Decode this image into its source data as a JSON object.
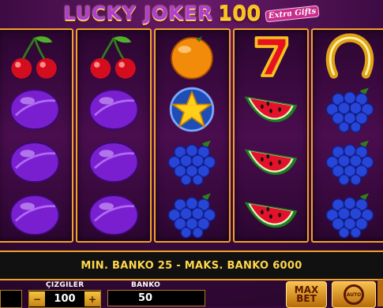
{
  "title": {
    "main": "LUCKY JOKER",
    "number": "100",
    "extra": "Extra Gifts"
  },
  "reels": [
    [
      "cherries",
      "plum",
      "plum",
      "plum"
    ],
    [
      "cherries",
      "plum",
      "plum",
      "plum"
    ],
    [
      "orange",
      "star",
      "grapes",
      "grapes"
    ],
    [
      "seven",
      "watermelon",
      "watermelon",
      "watermelon"
    ],
    [
      "horseshoe",
      "grapes",
      "grapes",
      "grapes"
    ]
  ],
  "info_text": "MIN. BANKO 25 - MAKS. BANKO 6000",
  "lines": {
    "label": "ÇIZGILER",
    "value": "100",
    "minus": "−",
    "plus": "+"
  },
  "bank": {
    "label": "BANKO",
    "value": "50"
  },
  "buttons": {
    "max": "MAX",
    "bet": "BET",
    "auto": "AUTO"
  },
  "colors": {
    "frame": "#f2a229",
    "info_text": "#ffd84a",
    "background": "#3b0b41"
  }
}
